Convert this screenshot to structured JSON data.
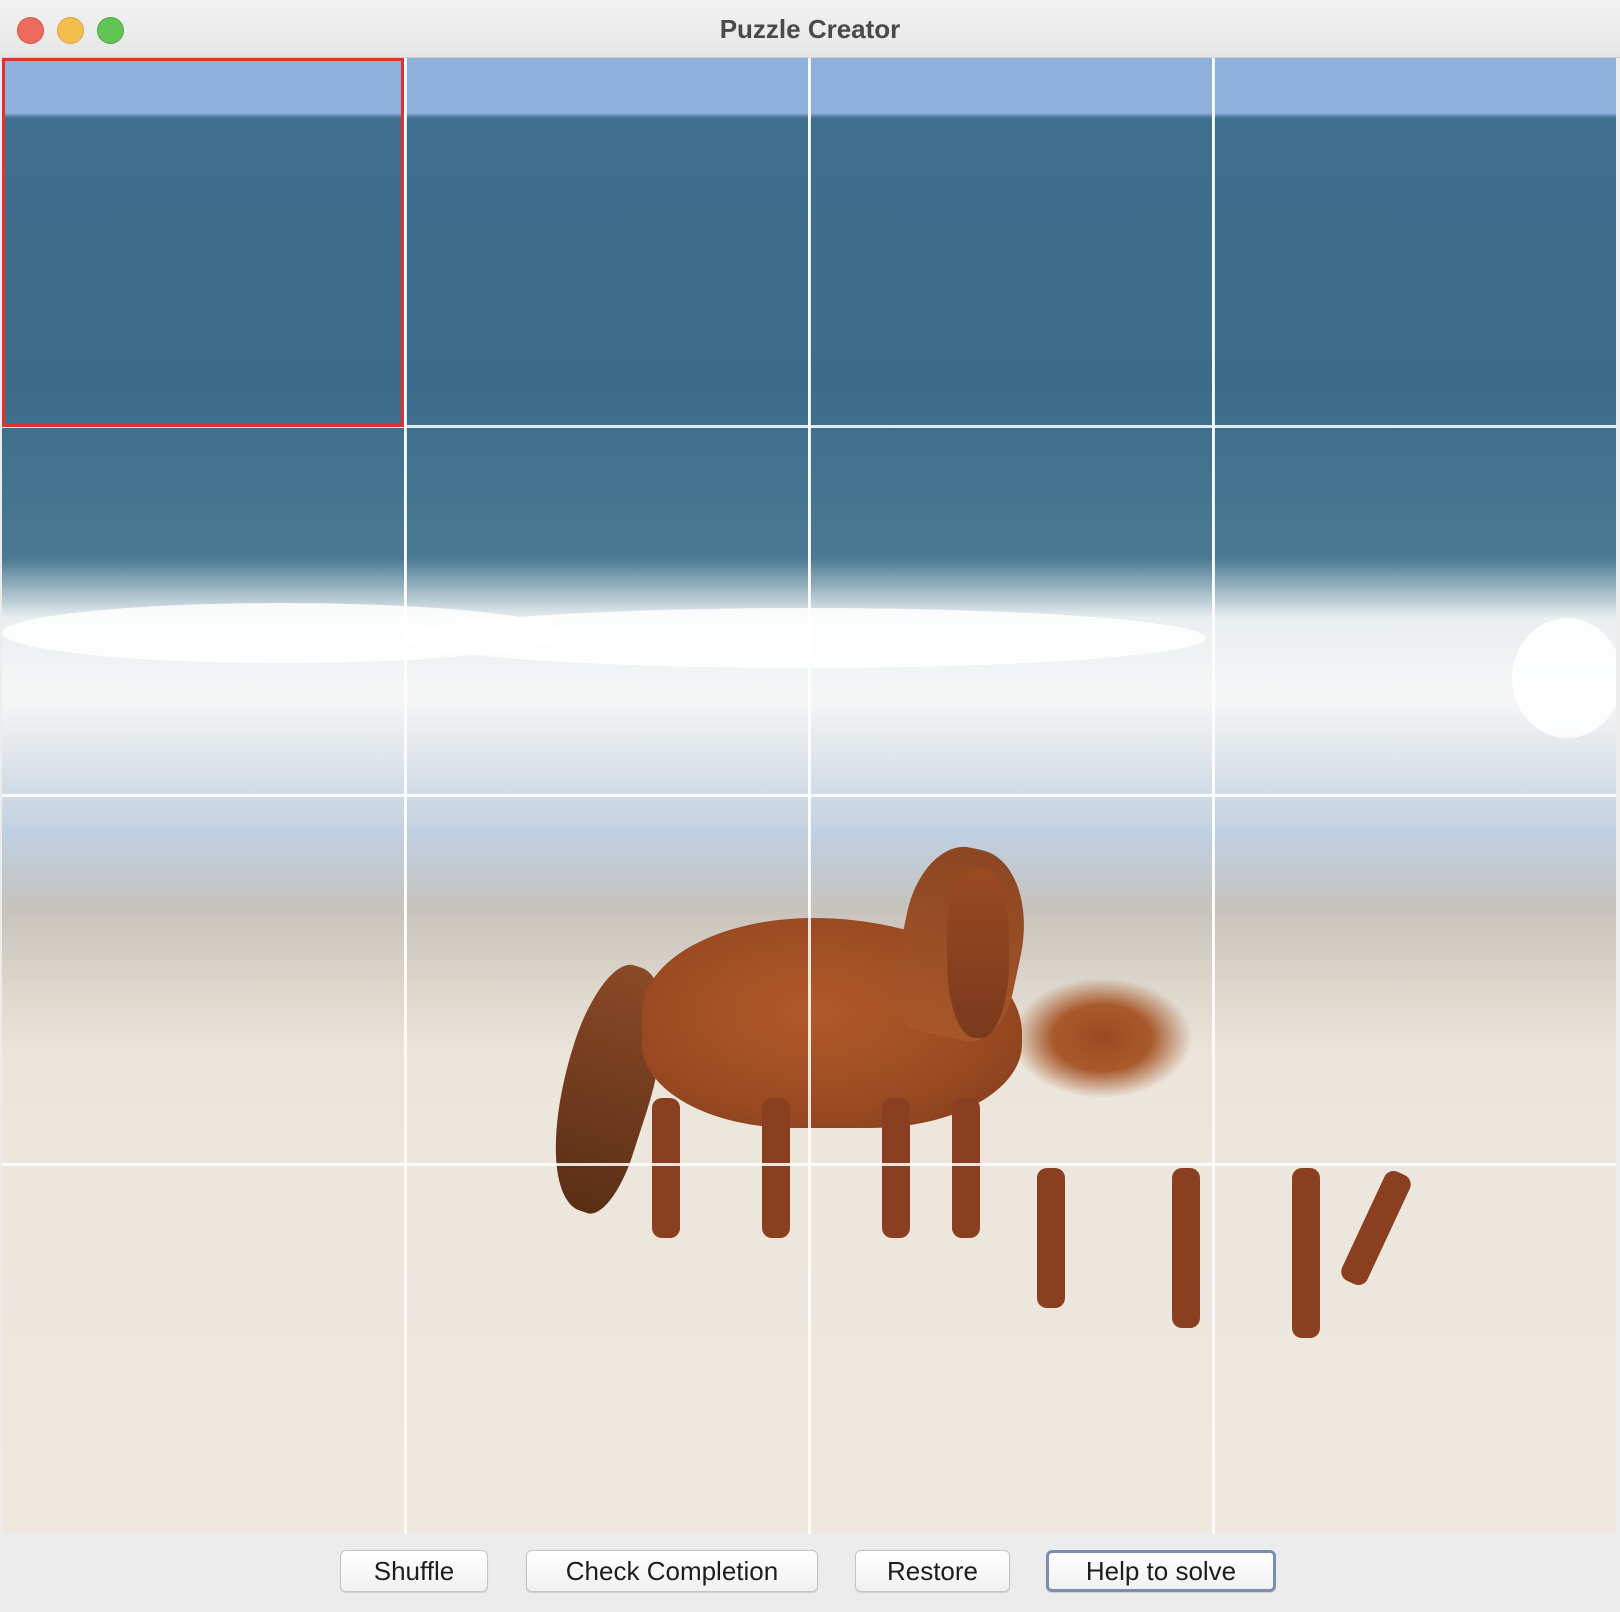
{
  "window": {
    "title": "Puzzle Creator"
  },
  "puzzle": {
    "rows": 4,
    "columns": 4,
    "selected_tile": "row 1, column 1"
  },
  "buttons": {
    "shuffle": "Shuffle",
    "check_completion": "Check Completion",
    "restore": "Restore",
    "help": "Help to solve"
  },
  "colors": {
    "selection_border": "#e03030",
    "close": "#ec6a5e",
    "minimize": "#f4be4f",
    "maximize": "#61c554"
  }
}
